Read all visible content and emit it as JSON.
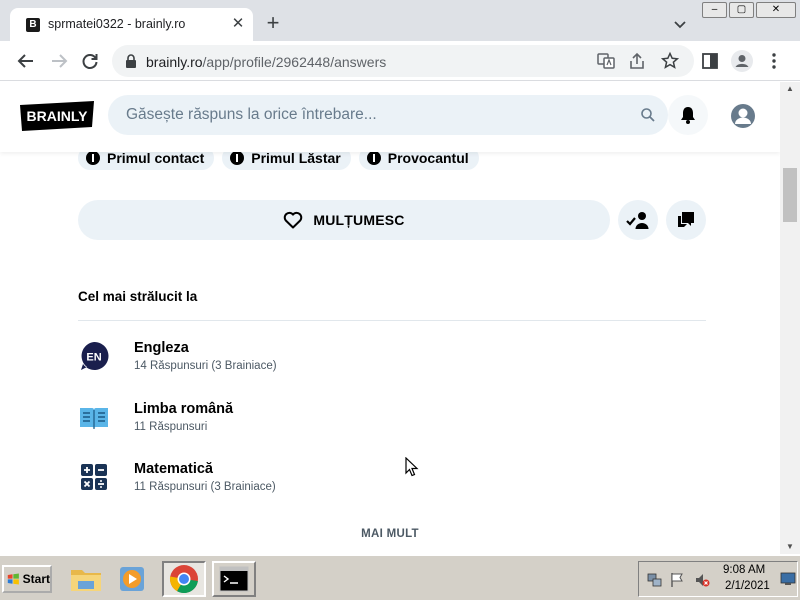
{
  "browser": {
    "tab_title": "sprmatei0322 - brainly.ro",
    "tab_favicon_letter": "B",
    "new_tab_label": "+",
    "url_host": "brainly.ro",
    "url_path": "/app/profile/2962448/answers",
    "window_buttons": [
      "–",
      "▢",
      "✕"
    ]
  },
  "site": {
    "logo_text": "BRAINLY",
    "search_placeholder": "Găsește răspuns la orice întrebare...",
    "colors": {
      "search_bg": "#ebf2f7",
      "text": "#000000",
      "muted": "#4c5964"
    }
  },
  "profile": {
    "badges": [
      "Primul contact",
      "Primul Lăstar",
      "Provocantul"
    ],
    "thanks_label": "MULȚUMESC",
    "section_title": "Cel mai strălucit la",
    "subjects": [
      {
        "name": "Engleza",
        "meta": "14 Răspunsuri (3 Brainiace)",
        "icon": "en-icon",
        "icon_text": "EN"
      },
      {
        "name": "Limba română",
        "meta": "11 Răspunsuri",
        "icon": "book-icon"
      },
      {
        "name": "Matematică",
        "meta": "11 Răspunsuri (3 Brainiace)",
        "icon": "math-icon"
      }
    ],
    "more_label": "MAI MULT"
  },
  "taskbar": {
    "start_label": "Start",
    "time": "9:08 AM",
    "date": "2/1/2021"
  }
}
